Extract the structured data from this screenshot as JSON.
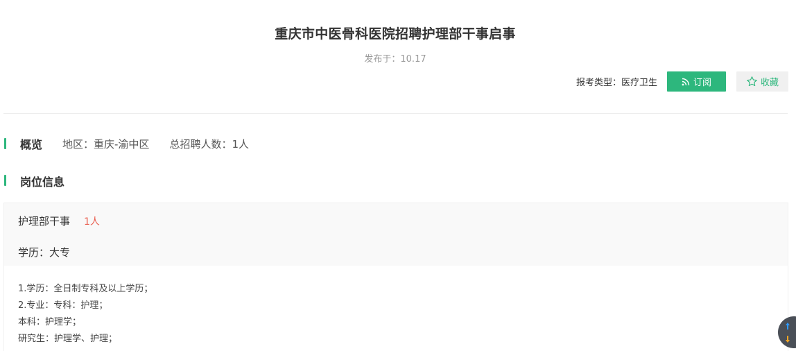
{
  "header": {
    "title": "重庆市中医骨科医院招聘护理部干事启事",
    "published_label": "发布于：",
    "published_date": "10.17"
  },
  "actions": {
    "exam_type_label": "报考类型：",
    "exam_type_value": "医疗卫生",
    "subscribe_label": "订阅",
    "favorite_label": "收藏"
  },
  "overview": {
    "heading": "概览",
    "region": "地区：重庆-渝中区",
    "total_hires": "总招聘人数：1人"
  },
  "positions": {
    "heading": "岗位信息",
    "items": [
      {
        "name": "护理部干事",
        "count": "1人",
        "education": "学历：大专",
        "requirements": [
          "1.学历：全日制专科及以上学历；",
          "2.专业：专科：护理；",
          "本科：护理学；",
          "研究生：护理学、护理；"
        ]
      }
    ]
  },
  "colors": {
    "accent": "#2db77d",
    "count_red": "#e95e4f",
    "float_bg": "#4a4f57",
    "arrow_up": "#2f9bff",
    "arrow_down": "#f5a623"
  }
}
